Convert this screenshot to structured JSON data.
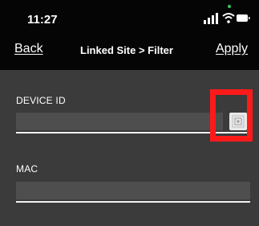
{
  "status_bar": {
    "time": "11:27",
    "icons": [
      "signal-icon",
      "wifi-icon",
      "battery-icon"
    ]
  },
  "nav": {
    "back_label": "Back",
    "title": "Linked Site > Filter",
    "apply_label": "Apply"
  },
  "form": {
    "device_id": {
      "label": "DEVICE ID",
      "value": ""
    },
    "mac": {
      "label": "MAC",
      "value": ""
    }
  },
  "colors": {
    "background": "#3b3b3b",
    "header": "#050505",
    "field": "#4e4e4e",
    "highlight": "#ff1a1a",
    "status_green": "#35c759"
  },
  "icons": {
    "scan_button": "qr-code-icon"
  }
}
